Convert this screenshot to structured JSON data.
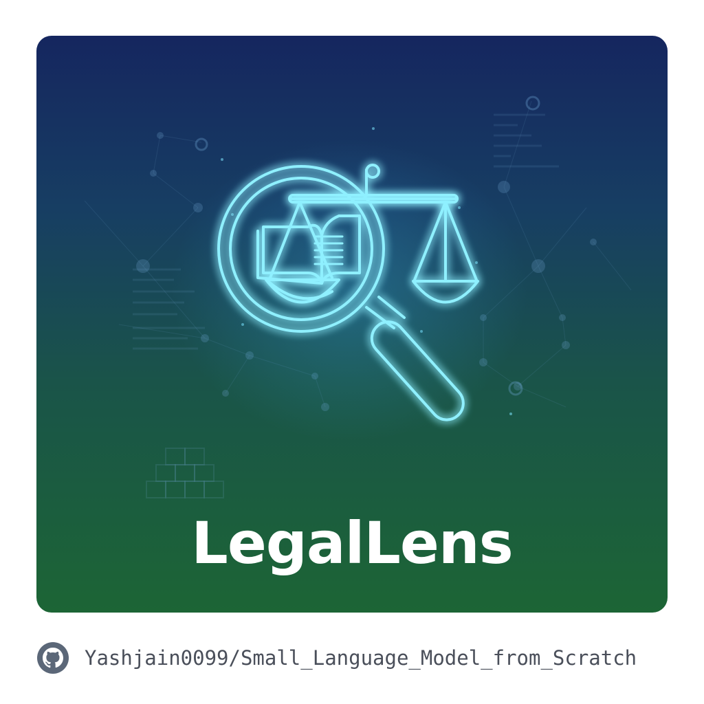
{
  "card": {
    "title": "LegalLens",
    "logo_icon": "magnifier-book-scales-icon",
    "colors": {
      "gradient_top": "#15265f",
      "gradient_bottom": "#1c6535",
      "glow": "#7fe7ff"
    }
  },
  "footer": {
    "icon": "github-icon",
    "repo": "Yashjain0099/Small_Language_Model_from_Scratch"
  }
}
